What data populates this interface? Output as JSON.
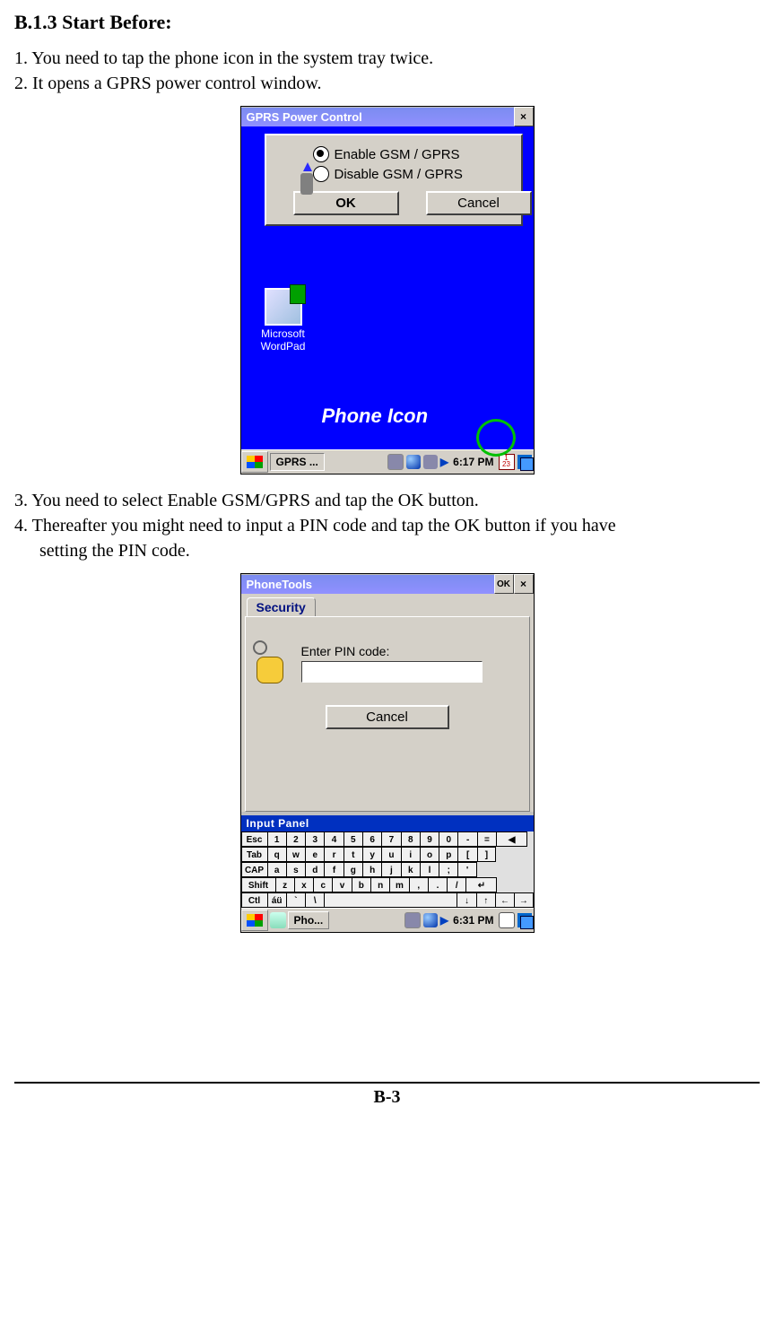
{
  "section_heading": "B.1.3 Start Before:",
  "steps": {
    "s1": "1. You need to tap the phone icon in the system tray twice.",
    "s2": "2. It opens a GPRS power control window.",
    "s3": "3. You need to select Enable GSM/GPRS and tap the OK button.",
    "s4a": "4. Thereafter you might need to input a PIN code and tap the OK button if you have",
    "s4b": "setting the PIN code."
  },
  "shot1": {
    "title": "GPRS Power Control",
    "radio_enable": "Enable GSM / GPRS",
    "radio_disable": "Disable GSM / GPRS",
    "ok": "OK",
    "cancel": "Cancel",
    "desktop_icon": {
      "line1": "Microsoft",
      "line2": "WordPad"
    },
    "callout": "Phone Icon",
    "taskbar": {
      "task_label": "GPRS ...",
      "time": "6:17 PM",
      "calendar_day": "1",
      "calendar_sub": "23"
    }
  },
  "shot2": {
    "title": "PhoneTools",
    "ok": "OK",
    "tab": "Security",
    "pin_label": "Enter PIN code:",
    "cancel": "Cancel",
    "sip_title": "Input Panel",
    "kb": {
      "row1": [
        "Esc",
        "1",
        "2",
        "3",
        "4",
        "5",
        "6",
        "7",
        "8",
        "9",
        "0",
        "-",
        "=",
        "◀"
      ],
      "row2": [
        "Tab",
        "q",
        "w",
        "e",
        "r",
        "t",
        "y",
        "u",
        "i",
        "o",
        "p",
        "[",
        "]"
      ],
      "row3": [
        "CAP",
        "a",
        "s",
        "d",
        "f",
        "g",
        "h",
        "j",
        "k",
        "l",
        ";",
        "'"
      ],
      "row4": [
        "Shift",
        "z",
        "x",
        "c",
        "v",
        "b",
        "n",
        "m",
        ",",
        ".",
        "/",
        "↵"
      ],
      "row5": [
        "Ctl",
        "áü",
        "`",
        "\\",
        " ",
        "↓",
        "↑",
        "←",
        "→"
      ]
    },
    "taskbar": {
      "task_label": "Pho...",
      "time": "6:31 PM"
    }
  },
  "page_number": "B-3"
}
